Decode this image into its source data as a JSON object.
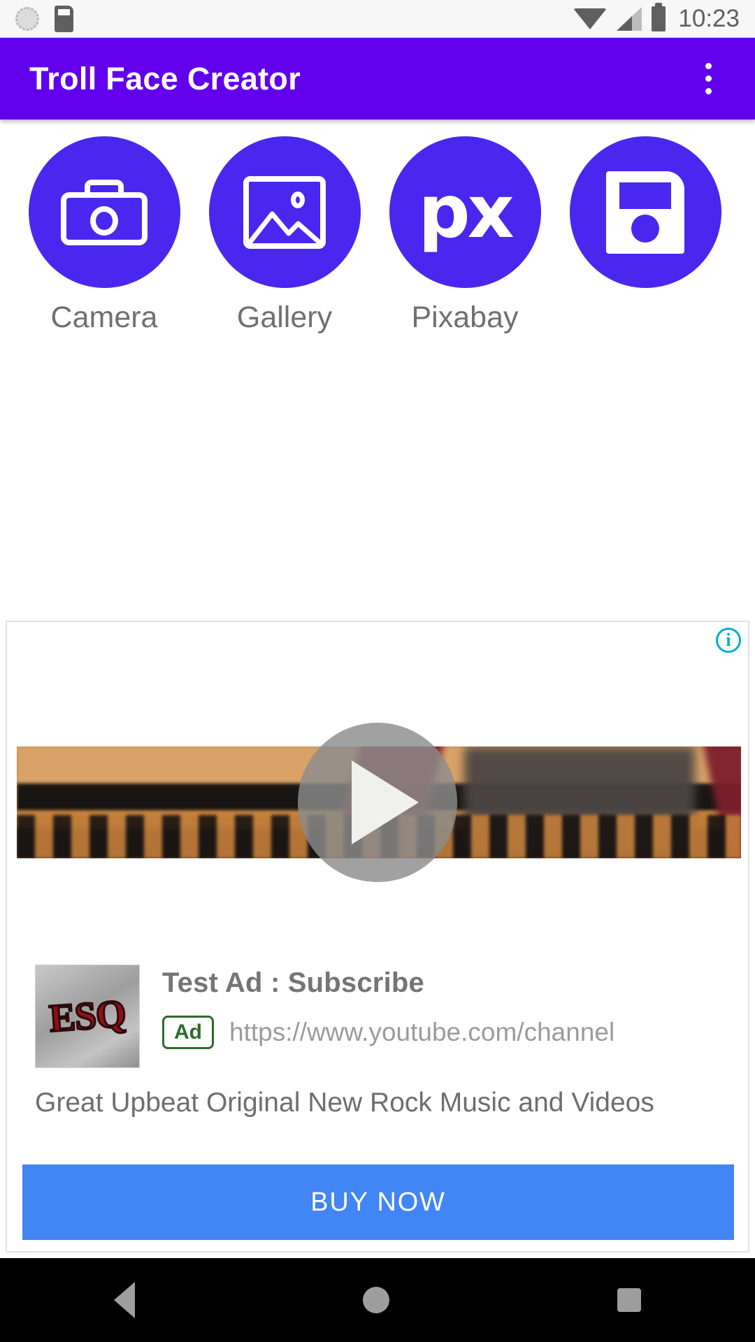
{
  "status_bar": {
    "time": "10:23",
    "icons": [
      "clock-icon",
      "sdcard-icon",
      "wifi-icon",
      "signal-icon",
      "battery-icon"
    ]
  },
  "app_bar": {
    "title": "Troll Face Creator",
    "overflow_menu": "overflow-menu-icon",
    "background_color": "#6200ee"
  },
  "actions": {
    "accent_color": "#4a27ef",
    "items": [
      {
        "label": "Camera",
        "icon": "camera-icon"
      },
      {
        "label": "Gallery",
        "icon": "image-icon"
      },
      {
        "label": "Pixabay",
        "icon": "px-logo-icon",
        "logo_text": "px"
      },
      {
        "label": "",
        "icon": "save-floppy-icon"
      }
    ]
  },
  "ad": {
    "info_icon_label": "i",
    "play_button": "play-icon",
    "headline": "Test Ad : Subscribe",
    "badge": "Ad",
    "url": "https://www.youtube.com/channel",
    "description": "Great Upbeat Original New Rock Music and Videos",
    "thumbnail_text": "ESQ",
    "cta_label": "BUY NOW",
    "cta_color": "#4285f4"
  },
  "nav_bar": {
    "back": "back-triangle-icon",
    "home": "home-circle-icon",
    "recents": "recents-square-icon"
  }
}
